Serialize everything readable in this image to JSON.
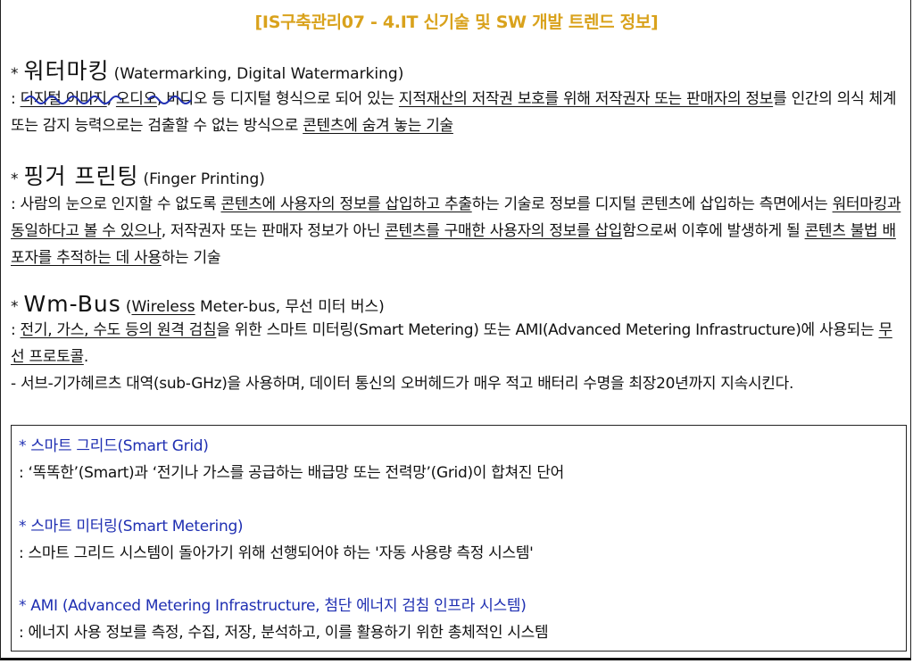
{
  "title": "[IS구축관리07 - 4.IT 신기술 및 SW 개발 트렌드 정보]",
  "star": "*",
  "watermarking": {
    "term": "워터마킹",
    "paren": "(Watermarking, Digital Watermarking)",
    "s1": ": ",
    "u1": "디지털 이미지",
    "s2": ", ",
    "u2": "오디오",
    "s3": ", 비디오 등 디지털 형식으로 되어 있는 ",
    "u3": "지적재산의 저작권 보호를 위해 저작권자 또는 판매자의 정보",
    "s4": "를 인간의 의식 체계 또는 감지 능력으로는 검출할 수 없는 방식으로 ",
    "u4": "콘텐츠에 숨겨 놓는 기술"
  },
  "fingerprinting": {
    "term": "핑거 프린팅",
    "paren": "(Finger Printing)",
    "s1": ": 사람의 눈으로 인지할 수 없도록 ",
    "u1": "콘텐츠에 사용자의 정보를 삽입하고 추출",
    "s2": "하는 기술로 정보를 디지털 콘텐츠에 삽입하는 측면에서는 ",
    "u2": "워터마킹과 동일하다고 볼 수 있으나",
    "s3": ", 저작권자 또는 판매자 정보가 아닌 ",
    "u3": "콘텐츠를 구매한 사용자의 정보를 삽입",
    "s4": "함으로써 이후에 발생하게 될 ",
    "u4": "콘텐츠 불법 배포자를 추적하는 데 사용",
    "s5": "하는 기술"
  },
  "wmbus": {
    "term": "Wm-Bus",
    "paren_open": "(",
    "paren_u": "Wireless",
    "paren_rest": " Meter-bus, 무선 미터 버스)",
    "s1": ": ",
    "u1": "전기, 가스, 수도 등의 원격 검침",
    "s2": "을 위한 스마트 미터링(Smart Metering) 또는 AMI(Advanced Metering Infrastructure)에 사용되는 ",
    "u2": "무선 프로토콜",
    "s3": ".",
    "line2": "- 서브-기가헤르츠 대역(sub-GHz)을 사용하며, 데이터 통신의 오버헤드가 매우 적고 배터리 수명을 최장20년까지 지속시킨다."
  },
  "box": {
    "items": [
      {
        "head": "* 스마트 그리드(Smart Grid)",
        "desc": ": ‘똑똑한’(Smart)과 ‘전기나 가스를 공급하는 배급망 또는 전력망’(Grid)이 합쳐진 단어"
      },
      {
        "head": "* 스마트 미터링(Smart Metering)",
        "desc": ": 스마트 그리드 시스템이 돌아가기 위해 선행되어야 하는 '자동 사용량 측정 시스템'"
      },
      {
        "head": "* AMI (Advanced Metering Infrastructure, 첨단 에너지 검침 인프라 시스템)",
        "desc": ": 에너지 사용 정보를 측정, 수집, 저장, 분석하고, 이를 활용하기 위한 총체적인 시스템"
      }
    ]
  },
  "colors": {
    "title": "#d9a21c",
    "box_heading": "#1f2fb2",
    "annotation": "#1f2fb2"
  }
}
